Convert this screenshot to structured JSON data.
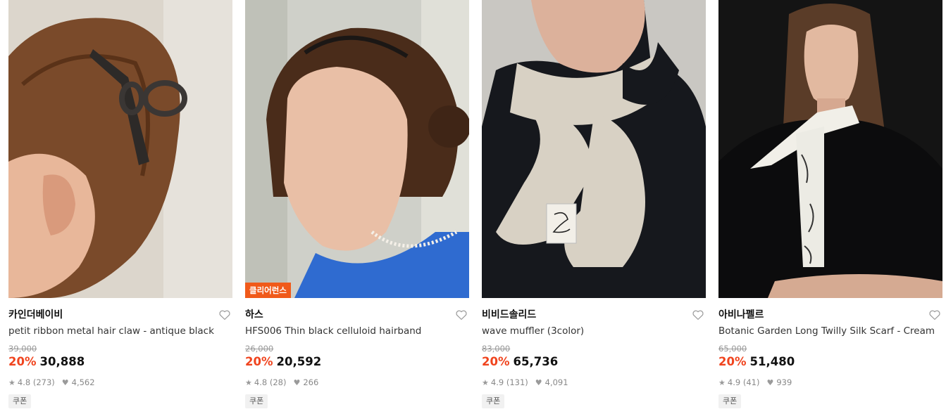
{
  "products": [
    {
      "brand": "카인더베이비",
      "name": "petit ribbon metal hair claw - antique black",
      "original_price": "39,000",
      "discount": "20%",
      "price": "30,888",
      "rating": "4.8",
      "reviews": "(273)",
      "likes": "4,562",
      "coupon": "쿠폰",
      "badge": ""
    },
    {
      "brand": "하스",
      "name": "HFS006 Thin black celluloid hairband",
      "original_price": "26,000",
      "discount": "20%",
      "price": "20,592",
      "rating": "4.8",
      "reviews": "(28)",
      "likes": "266",
      "coupon": "쿠폰",
      "badge": "클리어런스"
    },
    {
      "brand": "비비드솔리드",
      "name": "wave muffler (3color)",
      "original_price": "83,000",
      "discount": "20%",
      "price": "65,736",
      "rating": "4.9",
      "reviews": "(131)",
      "likes": "4,091",
      "coupon": "쿠폰",
      "badge": ""
    },
    {
      "brand": "아비나펠르",
      "name": "Botanic Garden Long Twilly Silk Scarf - Cream",
      "original_price": "65,000",
      "discount": "20%",
      "price": "51,480",
      "rating": "4.9",
      "reviews": "(41)",
      "likes": "939",
      "coupon": "쿠폰",
      "badge": ""
    }
  ],
  "icons": {
    "wishlist": "heart-outline-icon",
    "rating": "star-icon",
    "likes": "heart-filled-icon"
  },
  "colors": {
    "discount": "#f0441e",
    "badge": "#f05a1a"
  }
}
